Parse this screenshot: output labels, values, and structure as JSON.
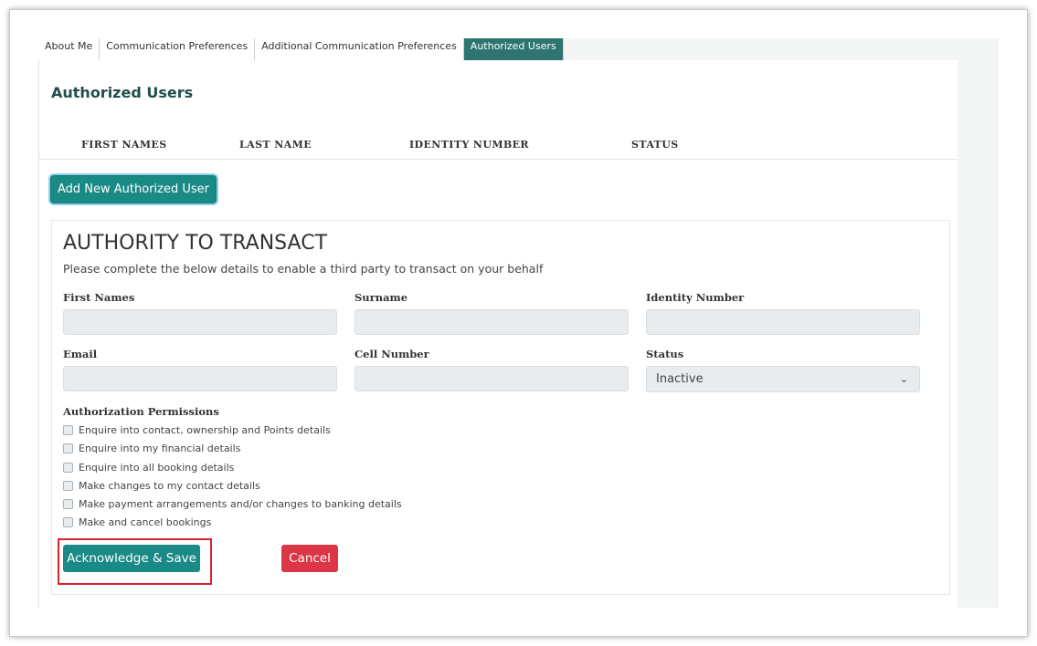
{
  "tabs": [
    {
      "label": "About Me",
      "active": false
    },
    {
      "label": "Communication Preferences",
      "active": false
    },
    {
      "label": "Additional Communication Preferences",
      "active": false
    },
    {
      "label": "Authorized Users",
      "active": true
    }
  ],
  "section": {
    "title": "Authorized Users",
    "columns": [
      "FIRST NAMES",
      "LAST NAME",
      "IDENTITY NUMBER",
      "STATUS"
    ],
    "add_button": "Add New Authorized User"
  },
  "form": {
    "heading": "AUTHORITY TO TRANSACT",
    "subtext": "Please complete the below details to enable a third party to transact on your behalf",
    "fields": {
      "first_names": {
        "label": "First Names",
        "value": ""
      },
      "surname": {
        "label": "Surname",
        "value": ""
      },
      "identity_number": {
        "label": "Identity Number",
        "value": ""
      },
      "email": {
        "label": "Email",
        "value": ""
      },
      "cell_number": {
        "label": "Cell Number",
        "value": ""
      },
      "status": {
        "label": "Status",
        "selected": "Inactive"
      }
    },
    "permissions_title": "Authorization Permissions",
    "permissions": [
      {
        "label": "Enquire into contact, ownership and Points details",
        "checked": false
      },
      {
        "label": "Enquire into my financial details",
        "checked": false
      },
      {
        "label": "Enquire into all booking details",
        "checked": false
      },
      {
        "label": "Make changes to my contact details",
        "checked": false
      },
      {
        "label": "Make payment arrangements and/or changes to banking details",
        "checked": false
      },
      {
        "label": "Make and cancel bookings",
        "checked": false
      }
    ],
    "save_button": "Acknowledge & Save",
    "cancel_button": "Cancel"
  },
  "icons": {
    "status_dropdown": "chevron-down-icon"
  },
  "colors": {
    "accent": "#1a8a86",
    "active_tab": "#2e7572",
    "cancel": "#dc3545",
    "highlight": "#d9232e"
  }
}
